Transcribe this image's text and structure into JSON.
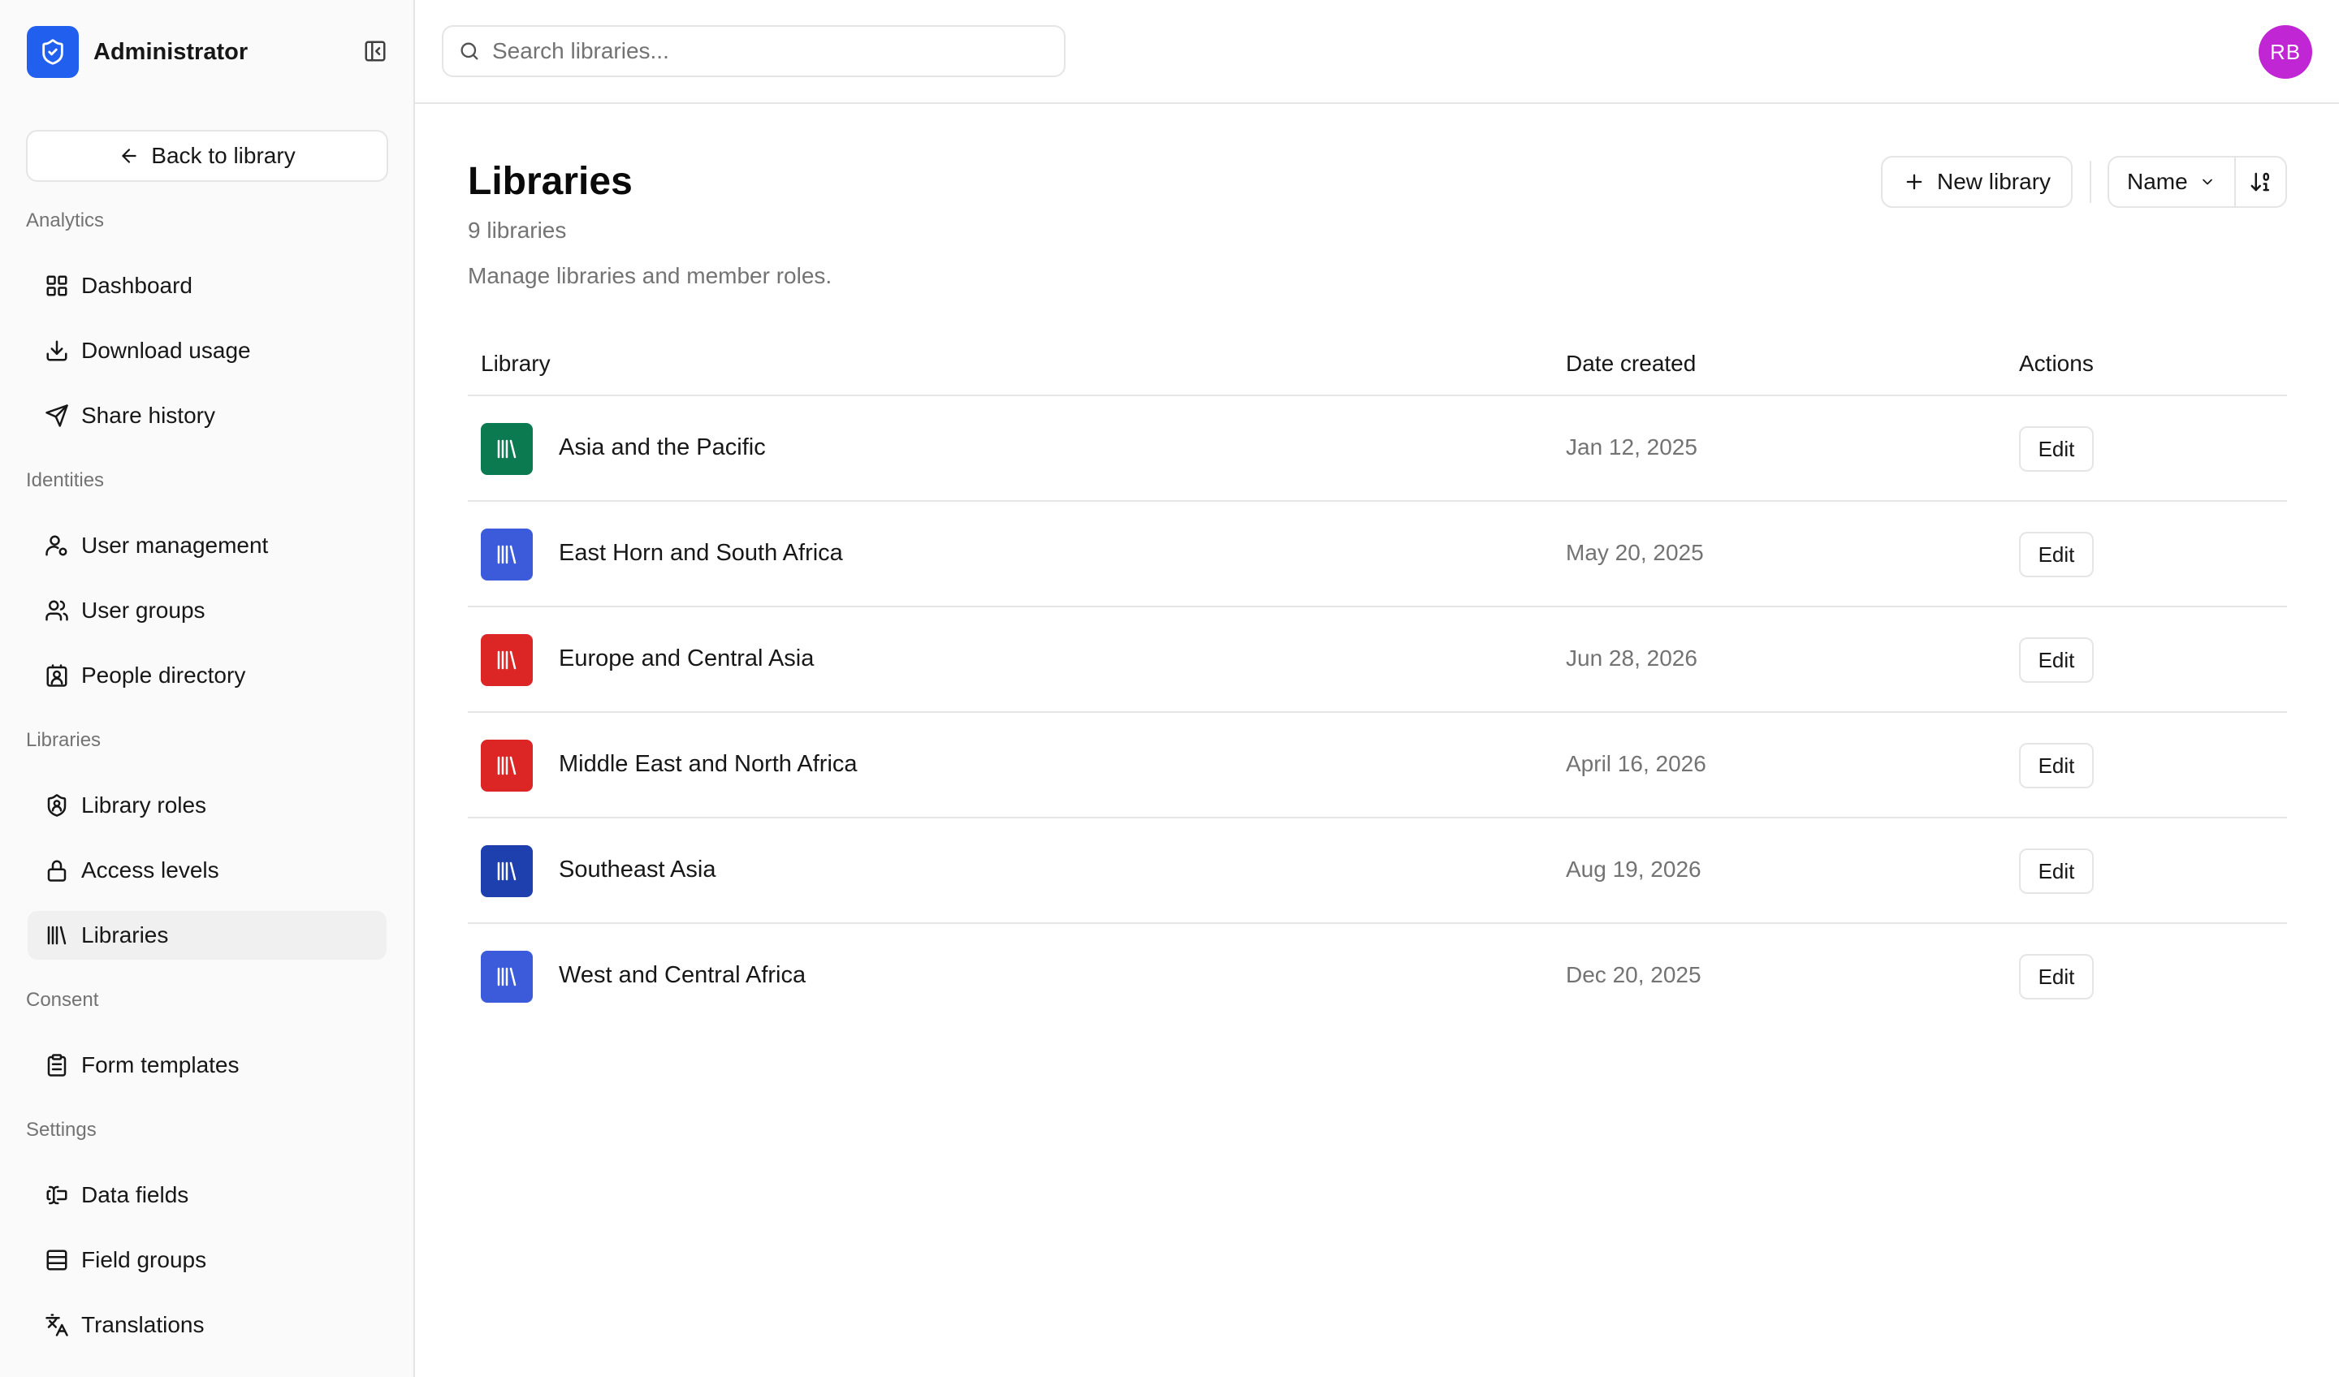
{
  "sidebar": {
    "brand": "Administrator",
    "back_label": "Back to library",
    "sections": [
      {
        "label": "Analytics",
        "items": [
          {
            "label": "Dashboard",
            "icon": "dashboard-icon"
          },
          {
            "label": "Download usage",
            "icon": "download-icon"
          },
          {
            "label": "Share history",
            "icon": "send-icon"
          }
        ]
      },
      {
        "label": "Identities",
        "items": [
          {
            "label": "User management",
            "icon": "user-cog-icon"
          },
          {
            "label": "User groups",
            "icon": "users-icon"
          },
          {
            "label": "People directory",
            "icon": "contact-icon"
          }
        ]
      },
      {
        "label": "Libraries",
        "items": [
          {
            "label": "Library roles",
            "icon": "shield-user-icon"
          },
          {
            "label": "Access levels",
            "icon": "lock-icon"
          },
          {
            "label": "Libraries",
            "icon": "library-icon",
            "active": true
          }
        ]
      },
      {
        "label": "Consent",
        "items": [
          {
            "label": "Form templates",
            "icon": "clipboard-icon"
          }
        ]
      },
      {
        "label": "Settings",
        "items": [
          {
            "label": "Data fields",
            "icon": "text-cursor-input-icon"
          },
          {
            "label": "Field groups",
            "icon": "rows-icon"
          },
          {
            "label": "Translations",
            "icon": "languages-icon"
          }
        ]
      }
    ]
  },
  "topbar": {
    "search_placeholder": "Search libraries...",
    "avatar_initials": "RB",
    "avatar_color": "#c026d3"
  },
  "main": {
    "title": "Libraries",
    "count": "9 libraries",
    "description": "Manage libraries and member roles.",
    "new_button": "New library",
    "sort_label": "Name"
  },
  "table": {
    "headers": [
      "Library",
      "Date created",
      "Actions"
    ],
    "rows": [
      {
        "name": "Asia and the Pacific",
        "date": "Jan 12, 2025",
        "action": "Edit",
        "color": "#0b7a50"
      },
      {
        "name": "East Horn and South Africa",
        "date": "May 20, 2025",
        "action": "Edit",
        "color": "#3b5bdb"
      },
      {
        "name": "Europe and Central Asia",
        "date": "Jun 28, 2026",
        "action": "Edit",
        "color": "#dc2626"
      },
      {
        "name": "Middle East and North Africa",
        "date": "April 16, 2026",
        "action": "Edit",
        "color": "#dc2626"
      },
      {
        "name": "Southeast Asia",
        "date": "Aug 19, 2026",
        "action": "Edit",
        "color": "#1e40af"
      },
      {
        "name": "West and Central Africa",
        "date": "Dec 20, 2025",
        "action": "Edit",
        "color": "#3b5bdb"
      }
    ]
  },
  "colors": {
    "brand": "#2160ee",
    "border": "#e5e5e5",
    "muted": "#737373"
  }
}
